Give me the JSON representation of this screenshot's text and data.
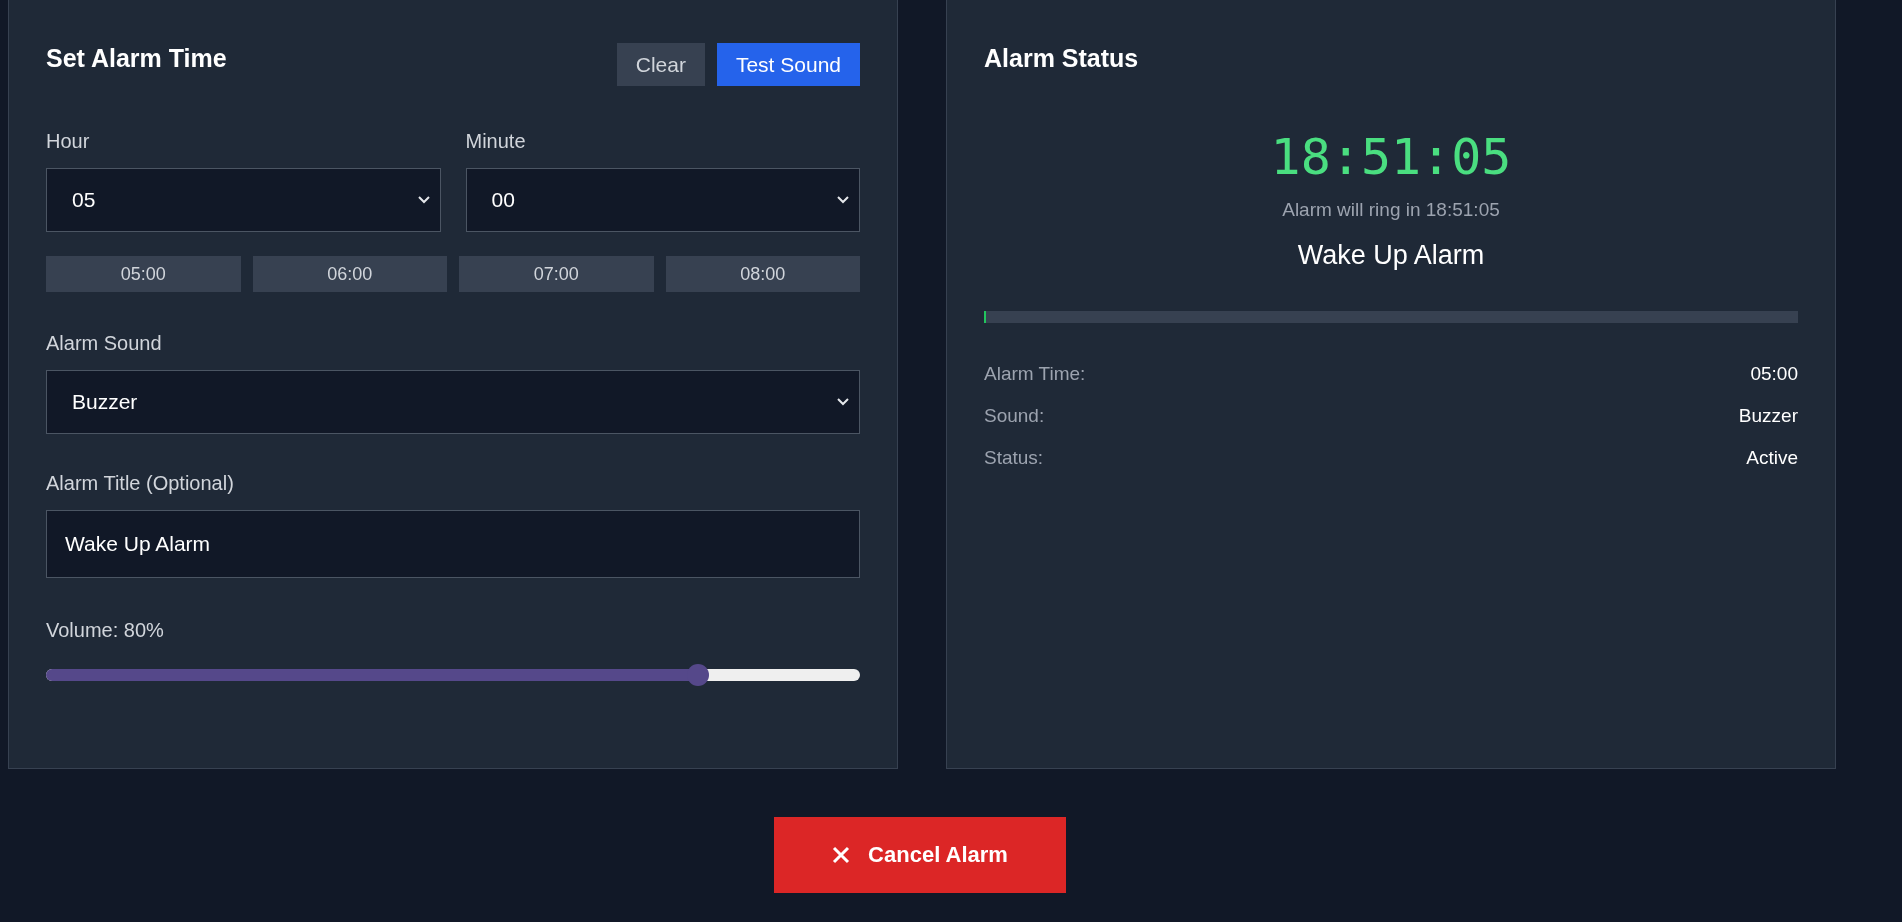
{
  "setup": {
    "title": "Set Alarm Time",
    "buttons": [
      {
        "label": "Clear",
        "kind": "secondary"
      },
      {
        "label": "Test Sound",
        "kind": "primary"
      }
    ],
    "hour": {
      "label": "Hour",
      "value": "05"
    },
    "minute": {
      "label": "Minute",
      "value": "00"
    },
    "presets": [
      "05:00",
      "06:00",
      "07:00",
      "08:00"
    ],
    "sound": {
      "label": "Alarm Sound",
      "value": "Buzzer"
    },
    "alarm_title": {
      "label": "Alarm Title (Optional)",
      "value": "Wake Up Alarm"
    },
    "volume": {
      "label": "Volume: 80%",
      "level": 0.8
    }
  },
  "status": {
    "title": "Alarm Status",
    "countdown": "18:51:05",
    "subtitle": "Alarm will ring in 18:51:05",
    "alarm_name": "Wake Up Alarm",
    "progress": {
      "level": 0.003
    },
    "details": [
      {
        "label": "Alarm Time:",
        "value": "05:00"
      },
      {
        "label": "Sound:",
        "value": "Buzzer"
      },
      {
        "label": "Status:",
        "value": "Active"
      }
    ]
  },
  "cancel_button": {
    "label": "Cancel Alarm"
  }
}
